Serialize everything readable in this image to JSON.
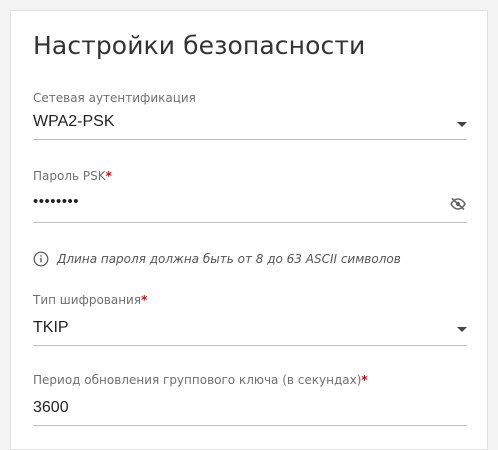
{
  "section": {
    "title": "Настройки безопасности"
  },
  "fields": {
    "auth": {
      "label": "Сетевая аутентификация",
      "value": "WPA2-PSK"
    },
    "psk": {
      "label": "Пароль PSK",
      "required_mark": "*",
      "value": "••••••••"
    },
    "hint": {
      "text": "Длина пароля должна быть от 8 до 63 ASCII символов"
    },
    "cipher": {
      "label": "Тип шифрования",
      "required_mark": "*",
      "value": "TKIP"
    },
    "rekey": {
      "label": "Период обновления группового ключа (в секундах)",
      "required_mark": "*",
      "value": "3600"
    }
  },
  "icons": {
    "dropdown": "chevron-down-icon",
    "visibility": "eye-off-icon",
    "info": "info-circle-icon"
  },
  "colors": {
    "required": "#e60000",
    "text": "#222222",
    "label": "#707070",
    "divider": "#bdbdbd"
  }
}
